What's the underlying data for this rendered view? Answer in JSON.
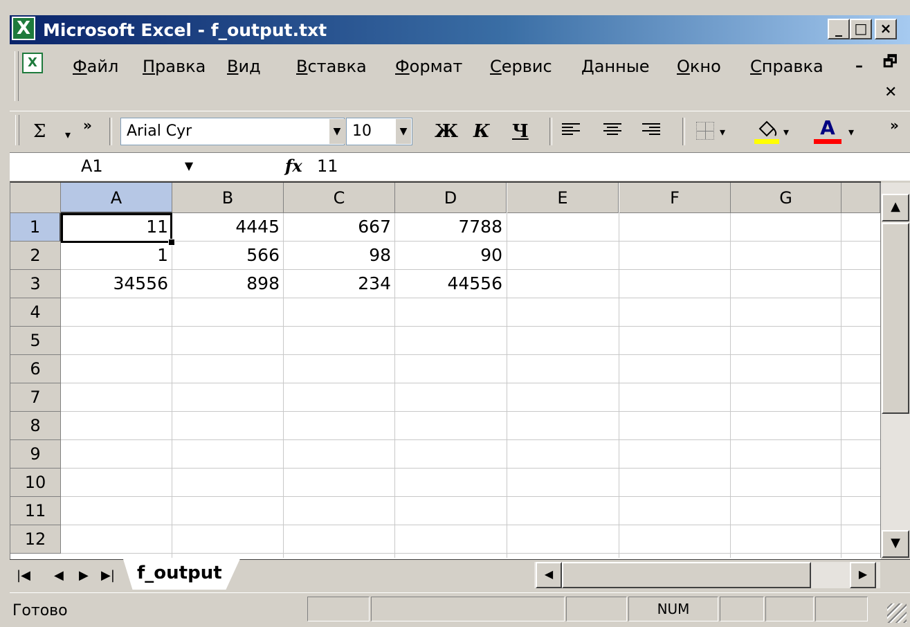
{
  "window": {
    "title": "Microsoft Excel - f_output.txt",
    "minimize_glyph": "_",
    "maximize_glyph": "□",
    "close_glyph": "×"
  },
  "menu": {
    "items": [
      "Файл",
      "Правка",
      "Вид",
      "Вставка",
      "Формат",
      "Сервис",
      "Данные",
      "Окно",
      "Справка"
    ],
    "doc_minimize_glyph": "–",
    "doc_restore_glyph": "🗗",
    "doc_close_glyph": "✕"
  },
  "toolbar": {
    "autosum_glyph": "Σ",
    "more_glyph": "»",
    "font_name": "Arial Cyr",
    "font_size": "10",
    "bold_label": "Ж",
    "italic_label": "К",
    "underline_label": "Ч",
    "font_color_glyph": "A",
    "fill_color": "#ffff00",
    "font_color": "#ff0000"
  },
  "formula_bar": {
    "name_box": "A1",
    "fx_label": "fx",
    "value": "11"
  },
  "grid": {
    "columns": [
      "A",
      "B",
      "C",
      "D",
      "E",
      "F",
      "G"
    ],
    "rows": [
      "1",
      "2",
      "3",
      "4",
      "5",
      "6",
      "7",
      "8",
      "9",
      "10",
      "11",
      "12"
    ],
    "cells": [
      [
        "11",
        "4445",
        "667",
        "7788"
      ],
      [
        "1",
        "566",
        "98",
        "90"
      ],
      [
        "34556",
        "898",
        "234",
        "44556"
      ]
    ],
    "active_cell": "A1",
    "selection_color": "#b6c7e5"
  },
  "sheets": {
    "tabs": [
      "f_output"
    ],
    "nav_first": "|◀",
    "nav_prev": "◀",
    "nav_next": "▶",
    "nav_last": "▶|"
  },
  "status": {
    "ready": "Готово",
    "num_indicator": "NUM"
  }
}
